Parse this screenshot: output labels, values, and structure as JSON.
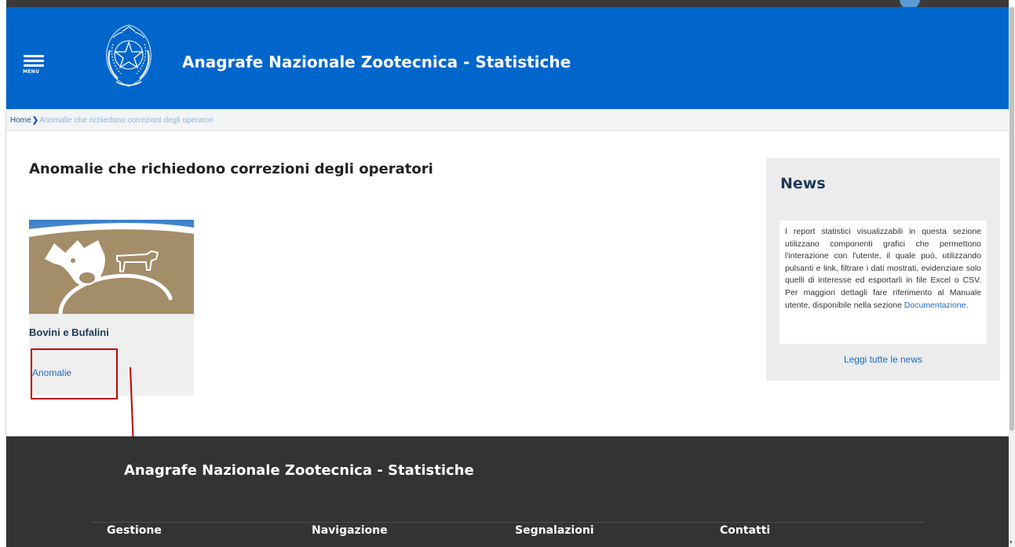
{
  "header": {
    "menu_label": "MENU",
    "site_title": "Anagrafe Nazionale Zootecnica - Statistiche"
  },
  "breadcrumb": {
    "home": "Home",
    "current": "Anomalie che richiedono correzioni degli operatori"
  },
  "main": {
    "page_title": "Anomalie che richiedono correzioni degli operatori",
    "cards": [
      {
        "title": "Bovini e Bufalini",
        "link": "Anomalie"
      }
    ]
  },
  "news": {
    "title": "News",
    "body": "I report statistici visualizzabili in questa sezione utilizzano componenti grafici che permettono l'interazione con l'utente, il quale può, utilizzando pulsanti e link, filtrare i dati mostrati, evidenziare solo quelli di interesse ed esportarli in file Excel o CSV. Per maggiori dettagli fare riferimento al Manuale utente, disponibile nella sezione ",
    "body_link": "Documentazione",
    "body_end": ".",
    "more_link": "Leggi tutte le news"
  },
  "footer": {
    "title": "Anagrafe Nazionale Zootecnica - Statistiche",
    "columns": [
      "Gestione",
      "Navigazione",
      "Segnalazioni",
      "Contatti"
    ]
  },
  "colors": {
    "header_blue": "#0066cc",
    "footer_dark": "#333333",
    "link_blue": "#1a6bc4",
    "highlight_red": "#c00000"
  },
  "icons": {
    "menu": "hamburger-menu-icon",
    "emblem": "italian-republic-emblem",
    "breadcrumb_separator": "chevron-right-icon"
  }
}
